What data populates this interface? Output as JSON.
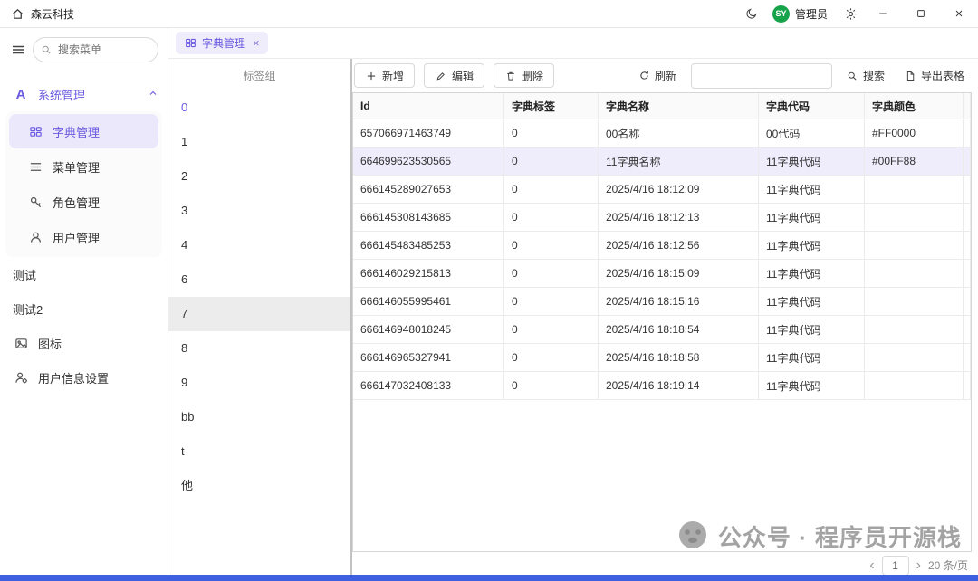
{
  "colors": {
    "accent": "#6A5AE0",
    "bottom_bar": "#3E5FE0",
    "avatar_bg": "#16A34A"
  },
  "titlebar": {
    "app_title": "森云科技",
    "avatar_text": "SY",
    "user_name": "管理员"
  },
  "sidebar": {
    "search_placeholder": "搜索菜单",
    "root_icon_letter": "A",
    "root_item": "系统管理",
    "sub_items": [
      "字典管理",
      "菜单管理",
      "角色管理",
      "用户管理"
    ],
    "plain_items": [
      "测试",
      "测试2"
    ],
    "icon_items": [
      "图标",
      "用户信息设置"
    ]
  },
  "tabbar": {
    "tabs": [
      {
        "label": "字典管理"
      }
    ]
  },
  "tag_panel": {
    "title": "标签组",
    "items": [
      "0",
      "1",
      "2",
      "3",
      "4",
      "6",
      "7",
      "8",
      "9",
      "bb",
      "t",
      "他"
    ],
    "selected": "0",
    "hovered": "7"
  },
  "toolbar": {
    "add_label": "新增",
    "edit_label": "编辑",
    "delete_label": "删除",
    "refresh_label": "刷新",
    "search_label": "搜索",
    "export_label": "导出表格",
    "search_value": ""
  },
  "table": {
    "columns": [
      "Id",
      "字典标签",
      "字典名称",
      "字典代码",
      "字典颜色",
      "字典颜色"
    ],
    "empty_cell": "-",
    "rows": [
      {
        "id": "657066971463749",
        "label": "0",
        "name": "00名称",
        "code": "00代码",
        "color": "#FF0000",
        "badge": {
          "text": "#FF0000",
          "bg": "#FF0000",
          "fg": "#FFFFFF"
        },
        "highlight": false
      },
      {
        "id": "664699623530565",
        "label": "0",
        "name": "11字典名称",
        "code": "11字典代码",
        "color": "#00FF88",
        "badge": {
          "text": "#00FF88",
          "bg": "#00FF88",
          "fg": "#333333"
        },
        "highlight": true
      },
      {
        "id": "666145289027653",
        "label": "0",
        "name": "2025/4/16 18:12:09",
        "code": "11字典代码",
        "color": "",
        "badge": null,
        "highlight": false
      },
      {
        "id": "666145308143685",
        "label": "0",
        "name": "2025/4/16 18:12:13",
        "code": "11字典代码",
        "color": "",
        "badge": null,
        "highlight": false
      },
      {
        "id": "666145483485253",
        "label": "0",
        "name": "2025/4/16 18:12:56",
        "code": "11字典代码",
        "color": "",
        "badge": null,
        "highlight": false
      },
      {
        "id": "666146029215813",
        "label": "0",
        "name": "2025/4/16 18:15:09",
        "code": "11字典代码",
        "color": "",
        "badge": null,
        "highlight": false
      },
      {
        "id": "666146055995461",
        "label": "0",
        "name": "2025/4/16 18:15:16",
        "code": "11字典代码",
        "color": "",
        "badge": null,
        "highlight": false
      },
      {
        "id": "666146948018245",
        "label": "0",
        "name": "2025/4/16 18:18:54",
        "code": "11字典代码",
        "color": "",
        "badge": null,
        "highlight": false
      },
      {
        "id": "666146965327941",
        "label": "0",
        "name": "2025/4/16 18:18:58",
        "code": "11字典代码",
        "color": "",
        "badge": null,
        "highlight": false
      },
      {
        "id": "666147032408133",
        "label": "0",
        "name": "2025/4/16 18:19:14",
        "code": "11字典代码",
        "color": "",
        "badge": null,
        "highlight": false
      }
    ]
  },
  "pagination": {
    "current_page": "1",
    "page_size": "20 条/页"
  },
  "watermark": {
    "text": "公众号 · 程序员开源栈"
  }
}
